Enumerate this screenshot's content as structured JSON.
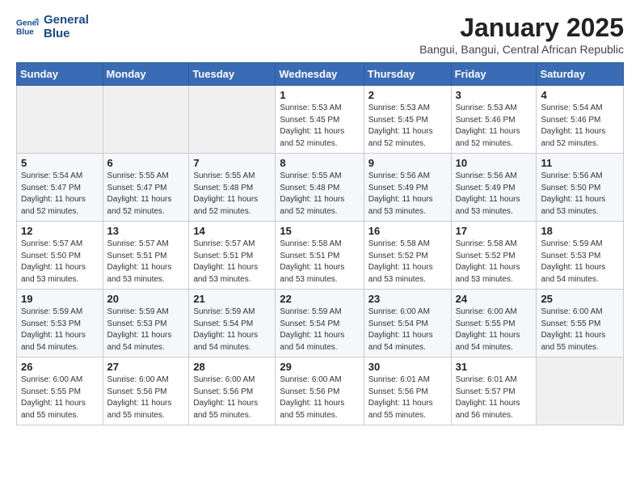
{
  "header": {
    "logo_line1": "General",
    "logo_line2": "Blue",
    "title": "January 2025",
    "subtitle": "Bangui, Bangui, Central African Republic"
  },
  "weekdays": [
    "Sunday",
    "Monday",
    "Tuesday",
    "Wednesday",
    "Thursday",
    "Friday",
    "Saturday"
  ],
  "weeks": [
    [
      {
        "day": "",
        "info": ""
      },
      {
        "day": "",
        "info": ""
      },
      {
        "day": "",
        "info": ""
      },
      {
        "day": "1",
        "info": "Sunrise: 5:53 AM\nSunset: 5:45 PM\nDaylight: 11 hours\nand 52 minutes."
      },
      {
        "day": "2",
        "info": "Sunrise: 5:53 AM\nSunset: 5:45 PM\nDaylight: 11 hours\nand 52 minutes."
      },
      {
        "day": "3",
        "info": "Sunrise: 5:53 AM\nSunset: 5:46 PM\nDaylight: 11 hours\nand 52 minutes."
      },
      {
        "day": "4",
        "info": "Sunrise: 5:54 AM\nSunset: 5:46 PM\nDaylight: 11 hours\nand 52 minutes."
      }
    ],
    [
      {
        "day": "5",
        "info": "Sunrise: 5:54 AM\nSunset: 5:47 PM\nDaylight: 11 hours\nand 52 minutes."
      },
      {
        "day": "6",
        "info": "Sunrise: 5:55 AM\nSunset: 5:47 PM\nDaylight: 11 hours\nand 52 minutes."
      },
      {
        "day": "7",
        "info": "Sunrise: 5:55 AM\nSunset: 5:48 PM\nDaylight: 11 hours\nand 52 minutes."
      },
      {
        "day": "8",
        "info": "Sunrise: 5:55 AM\nSunset: 5:48 PM\nDaylight: 11 hours\nand 52 minutes."
      },
      {
        "day": "9",
        "info": "Sunrise: 5:56 AM\nSunset: 5:49 PM\nDaylight: 11 hours\nand 53 minutes."
      },
      {
        "day": "10",
        "info": "Sunrise: 5:56 AM\nSunset: 5:49 PM\nDaylight: 11 hours\nand 53 minutes."
      },
      {
        "day": "11",
        "info": "Sunrise: 5:56 AM\nSunset: 5:50 PM\nDaylight: 11 hours\nand 53 minutes."
      }
    ],
    [
      {
        "day": "12",
        "info": "Sunrise: 5:57 AM\nSunset: 5:50 PM\nDaylight: 11 hours\nand 53 minutes."
      },
      {
        "day": "13",
        "info": "Sunrise: 5:57 AM\nSunset: 5:51 PM\nDaylight: 11 hours\nand 53 minutes."
      },
      {
        "day": "14",
        "info": "Sunrise: 5:57 AM\nSunset: 5:51 PM\nDaylight: 11 hours\nand 53 minutes."
      },
      {
        "day": "15",
        "info": "Sunrise: 5:58 AM\nSunset: 5:51 PM\nDaylight: 11 hours\nand 53 minutes."
      },
      {
        "day": "16",
        "info": "Sunrise: 5:58 AM\nSunset: 5:52 PM\nDaylight: 11 hours\nand 53 minutes."
      },
      {
        "day": "17",
        "info": "Sunrise: 5:58 AM\nSunset: 5:52 PM\nDaylight: 11 hours\nand 53 minutes."
      },
      {
        "day": "18",
        "info": "Sunrise: 5:59 AM\nSunset: 5:53 PM\nDaylight: 11 hours\nand 54 minutes."
      }
    ],
    [
      {
        "day": "19",
        "info": "Sunrise: 5:59 AM\nSunset: 5:53 PM\nDaylight: 11 hours\nand 54 minutes."
      },
      {
        "day": "20",
        "info": "Sunrise: 5:59 AM\nSunset: 5:53 PM\nDaylight: 11 hours\nand 54 minutes."
      },
      {
        "day": "21",
        "info": "Sunrise: 5:59 AM\nSunset: 5:54 PM\nDaylight: 11 hours\nand 54 minutes."
      },
      {
        "day": "22",
        "info": "Sunrise: 5:59 AM\nSunset: 5:54 PM\nDaylight: 11 hours\nand 54 minutes."
      },
      {
        "day": "23",
        "info": "Sunrise: 6:00 AM\nSunset: 5:54 PM\nDaylight: 11 hours\nand 54 minutes."
      },
      {
        "day": "24",
        "info": "Sunrise: 6:00 AM\nSunset: 5:55 PM\nDaylight: 11 hours\nand 54 minutes."
      },
      {
        "day": "25",
        "info": "Sunrise: 6:00 AM\nSunset: 5:55 PM\nDaylight: 11 hours\nand 55 minutes."
      }
    ],
    [
      {
        "day": "26",
        "info": "Sunrise: 6:00 AM\nSunset: 5:55 PM\nDaylight: 11 hours\nand 55 minutes."
      },
      {
        "day": "27",
        "info": "Sunrise: 6:00 AM\nSunset: 5:56 PM\nDaylight: 11 hours\nand 55 minutes."
      },
      {
        "day": "28",
        "info": "Sunrise: 6:00 AM\nSunset: 5:56 PM\nDaylight: 11 hours\nand 55 minutes."
      },
      {
        "day": "29",
        "info": "Sunrise: 6:00 AM\nSunset: 5:56 PM\nDaylight: 11 hours\nand 55 minutes."
      },
      {
        "day": "30",
        "info": "Sunrise: 6:01 AM\nSunset: 5:56 PM\nDaylight: 11 hours\nand 55 minutes."
      },
      {
        "day": "31",
        "info": "Sunrise: 6:01 AM\nSunset: 5:57 PM\nDaylight: 11 hours\nand 56 minutes."
      },
      {
        "day": "",
        "info": ""
      }
    ]
  ]
}
